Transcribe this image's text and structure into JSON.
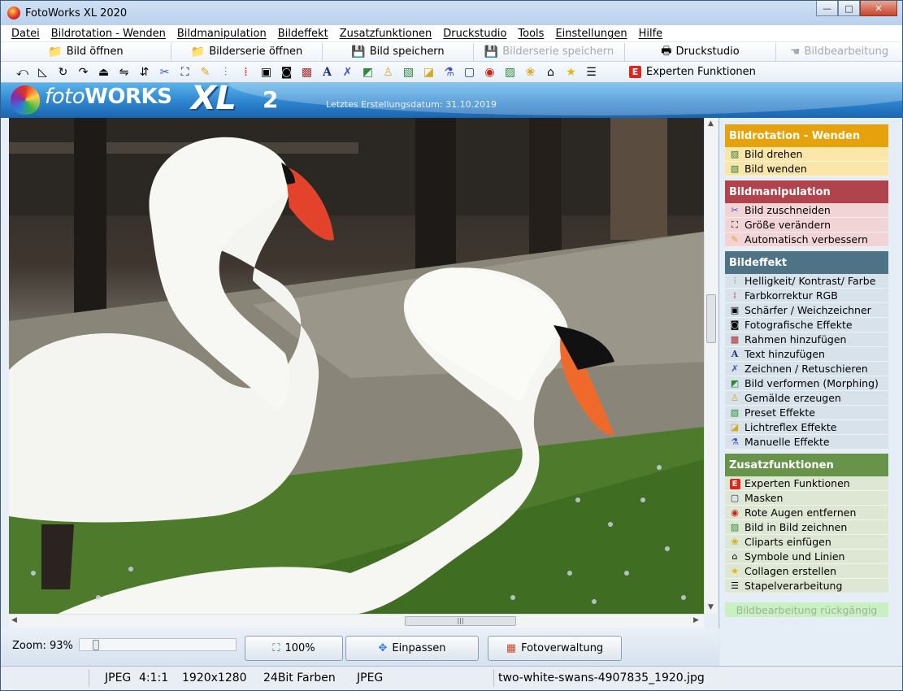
{
  "window": {
    "title": "FotoWorks XL 2020"
  },
  "menu": [
    "Datei",
    "Bildrotation - Wenden",
    "Bildmanipulation",
    "Bildeffekt",
    "Zusatzfunktionen",
    "Druckstudio",
    "Tools",
    "Einstellungen",
    "Hilfe"
  ],
  "toolbar1": {
    "open_image": "Bild öffnen",
    "open_series": "Bilderserie öffnen",
    "save_image": "Bild speichern",
    "save_series": "Bilderserie speichern",
    "print_studio": "Druckstudio",
    "editing": "Bildbearbeitung"
  },
  "toolbar2": {
    "expert": "Experten Funktionen"
  },
  "banner": {
    "logo_foto": "foto",
    "logo_works": "WORKS",
    "logo_xl": "XL",
    "logo_version": "2",
    "build_date": "Letztes Erstellungsdatum: 31.10.2019"
  },
  "bottom": {
    "zoom": "Zoom: 93%",
    "zoom_level_percent": 93,
    "btn_100": "100%",
    "btn_fit": "Einpassen",
    "btn_manager": "Fotoverwaltung"
  },
  "sidebar": {
    "rotation": {
      "title": "Bildrotation - Wenden",
      "color": "#e6a20a",
      "items": [
        "Bild drehen",
        "Bild wenden"
      ]
    },
    "manipulation": {
      "title": "Bildmanipulation",
      "color": "#b0434c",
      "items": [
        "Bild zuschneiden",
        "Größe verändern",
        "Automatisch verbessern"
      ]
    },
    "effect": {
      "title": "Bildeffekt",
      "color": "#4f7386",
      "items": [
        "Helligkeit/ Kontrast/ Farbe",
        "Farbkorrektur RGB",
        "Schärfer / Weichzeichner",
        "Fotografische Effekte",
        "Rahmen hinzufügen",
        "Text hinzufügen",
        "Zeichnen / Retuschieren",
        "Bild verformen (Morphing)",
        "Gemälde erzeugen",
        "Preset Effekte",
        "Lichtreflex Effekte",
        "Manuelle Effekte"
      ]
    },
    "extra": {
      "title": "Zusatzfunktionen",
      "color": "#67944a",
      "items": [
        "Experten Funktionen",
        "Masken",
        "Rote Augen entfernen",
        "Bild in Bild zeichnen",
        "Cliparts einfügen",
        "Symbole und Linien",
        "Collagen erstellen",
        "Stapelverarbeitung"
      ]
    },
    "undo": "Bildbearbeitung rückgängig"
  },
  "status": {
    "format": "JPEG",
    "sampling": "4:1:1",
    "size": "1920x1280",
    "depth": "24Bit Farben",
    "type": "JPEG",
    "filename": "two-white-swans-4907835_1920.jpg"
  }
}
